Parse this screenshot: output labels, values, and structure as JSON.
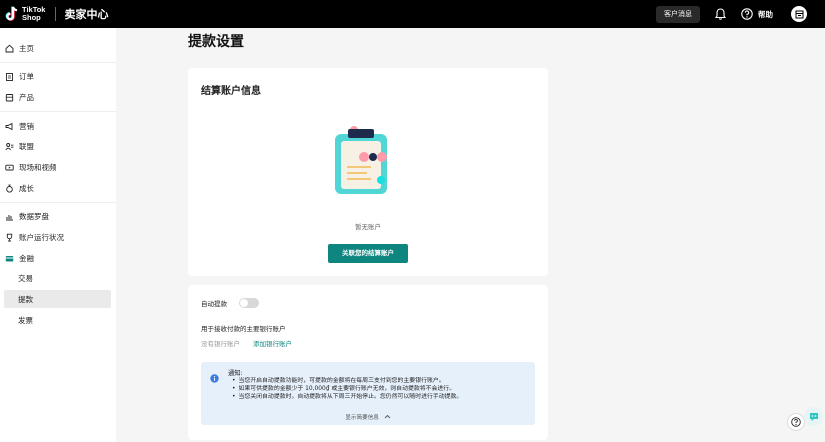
{
  "header": {
    "logo_line1": "TikTok",
    "logo_line2": "Shop",
    "app_title": "卖家中心",
    "customer_message": "客户消息",
    "help": "帮助"
  },
  "sidebar": {
    "items": [
      {
        "label": "主页",
        "icon": "home-icon"
      },
      {
        "label": "订单",
        "icon": "clipboard-icon"
      },
      {
        "label": "产品",
        "icon": "box-icon"
      },
      {
        "label": "营销",
        "icon": "megaphone-icon"
      },
      {
        "label": "联盟",
        "icon": "users-icon"
      },
      {
        "label": "现场和视频",
        "icon": "video-icon"
      },
      {
        "label": "成长",
        "icon": "growth-icon"
      },
      {
        "label": "数据罗盘",
        "icon": "chart-icon"
      },
      {
        "label": "账户运行状况",
        "icon": "trophy-icon"
      },
      {
        "label": "金融",
        "icon": "wallet-icon"
      },
      {
        "label": "交易"
      },
      {
        "label": "提款"
      },
      {
        "label": "发票"
      }
    ]
  },
  "page": {
    "title": "提款设置"
  },
  "settlement": {
    "title": "结算账户信息",
    "empty_text": "暂无账户",
    "link_button": "关联您的结算账户"
  },
  "auto_withdraw": {
    "label": "自动提款",
    "enabled": false,
    "main_account_label": "用于接收付款的主要银行账户",
    "no_account": "没有银行账户",
    "add_account": "添加银行账户",
    "notice": {
      "title": "通知:",
      "items": [
        "当您开启自动提款功能时，可提款的金额将在每周三支付到您的主要银行账户。",
        "如果可供提款的金额少于 10,000₫ 或主要银行账户无效，则自动提款将不会进行。",
        "当您关闭自动提款时，自动提款将从下周三开始停止。您仍然可以随时进行手动提款。"
      ],
      "show_less": "显示简要信息"
    }
  },
  "colors": {
    "accent": "#0f857f",
    "notice_bg": "#e6f0fb",
    "topbar": "#000000"
  }
}
